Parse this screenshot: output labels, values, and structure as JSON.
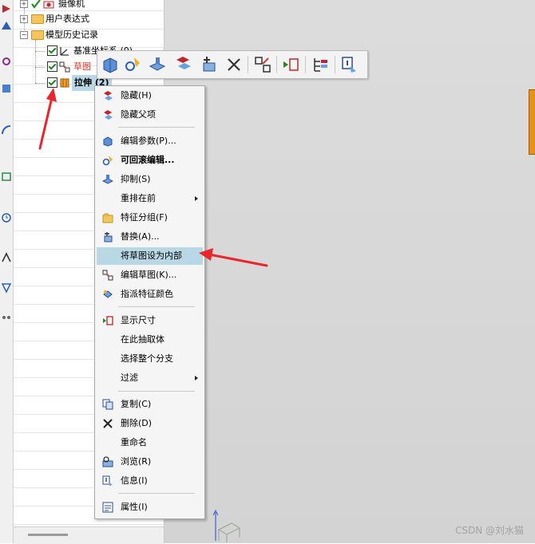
{
  "navigator": {
    "rows": [
      {
        "label": "摄像机"
      },
      {
        "label": "用户表达式"
      },
      {
        "label": "模型历史记录"
      },
      {
        "label": "基准坐标系 (0)"
      },
      {
        "label": "草图"
      },
      {
        "label": "拉伸 (2)"
      }
    ]
  },
  "menu": {
    "items": [
      {
        "label": "隐藏(H)"
      },
      {
        "label": "隐藏父项"
      },
      {
        "label": "编辑参数(P)..."
      },
      {
        "label": "可回滚编辑..."
      },
      {
        "label": "抑制(S)"
      },
      {
        "label": "重排在前"
      },
      {
        "label": "特征分组(F)"
      },
      {
        "label": "替换(A)..."
      },
      {
        "label": "将草图设为内部"
      },
      {
        "label": "编辑草图(K)..."
      },
      {
        "label": "指派特征颜色"
      },
      {
        "label": "显示尺寸"
      },
      {
        "label": "在此抽取体"
      },
      {
        "label": "选择整个分支"
      },
      {
        "label": "过滤"
      },
      {
        "label": "复制(C)"
      },
      {
        "label": "删除(D)"
      },
      {
        "label": "重命名"
      },
      {
        "label": "浏览(R)"
      },
      {
        "label": "信息(I)"
      },
      {
        "label": "属性(I)"
      }
    ]
  },
  "watermark": "CSDN @刘水猫",
  "colors": {
    "highlight": "#b9d8e6",
    "annotation_arrow": "#e8262b",
    "part": "#e8901c",
    "sketch_label": "#e03a2e"
  }
}
